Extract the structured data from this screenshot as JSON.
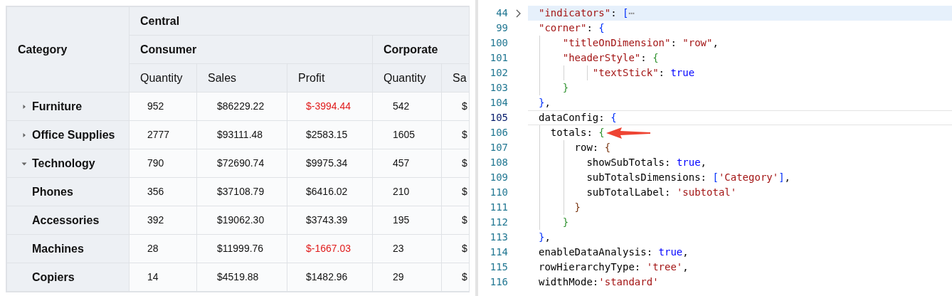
{
  "pivot_table": {
    "corner_title": "Category",
    "column_groups": [
      {
        "label": "Central",
        "children": [
          {
            "label": "Consumer",
            "measures": [
              "Quantity",
              "Sales",
              "Profit"
            ]
          },
          {
            "label": "Corporate",
            "measures": [
              "Quantity",
              "Sa"
            ]
          }
        ]
      }
    ],
    "rows": [
      {
        "label": "Furniture",
        "expanded": false,
        "cells": [
          {
            "text": "952",
            "negative": false
          },
          {
            "text": "$86229.22",
            "negative": false
          },
          {
            "text": "$-3994.44",
            "negative": true
          },
          {
            "text": "542",
            "negative": false
          },
          {
            "text": "$",
            "negative": false
          }
        ]
      },
      {
        "label": "Office Supplies",
        "expanded": false,
        "cells": [
          {
            "text": "2777",
            "negative": false
          },
          {
            "text": "$93111.48",
            "negative": false
          },
          {
            "text": "$2583.15",
            "negative": false
          },
          {
            "text": "1605",
            "negative": false
          },
          {
            "text": "$",
            "negative": false
          }
        ]
      },
      {
        "label": "Technology",
        "expanded": true,
        "cells": [
          {
            "text": "790",
            "negative": false
          },
          {
            "text": "$72690.74",
            "negative": false
          },
          {
            "text": "$9975.34",
            "negative": false
          },
          {
            "text": "457",
            "negative": false
          },
          {
            "text": "$",
            "negative": false
          }
        ],
        "children": [
          {
            "label": "Phones",
            "cells": [
              {
                "text": "356",
                "negative": false
              },
              {
                "text": "$37108.79",
                "negative": false
              },
              {
                "text": "$6416.02",
                "negative": false
              },
              {
                "text": "210",
                "negative": false
              },
              {
                "text": "$",
                "negative": false
              }
            ]
          },
          {
            "label": "Accessories",
            "cells": [
              {
                "text": "392",
                "negative": false
              },
              {
                "text": "$19062.30",
                "negative": false
              },
              {
                "text": "$3743.39",
                "negative": false
              },
              {
                "text": "195",
                "negative": false
              },
              {
                "text": "$",
                "negative": false
              }
            ]
          },
          {
            "label": "Machines",
            "cells": [
              {
                "text": "28",
                "negative": false
              },
              {
                "text": "$11999.76",
                "negative": false
              },
              {
                "text": "$-1667.03",
                "negative": true
              },
              {
                "text": "23",
                "negative": false
              },
              {
                "text": "$",
                "negative": false
              }
            ]
          },
          {
            "label": "Copiers",
            "cells": [
              {
                "text": "14",
                "negative": false
              },
              {
                "text": "$4519.88",
                "negative": false
              },
              {
                "text": "$1482.96",
                "negative": false
              },
              {
                "text": "29",
                "negative": false
              },
              {
                "text": "$",
                "negative": false
              }
            ]
          }
        ]
      }
    ]
  },
  "code_editor": {
    "lines": [
      {
        "number": "44",
        "folded": true,
        "highlighted": true,
        "current": false,
        "marked": false,
        "tokens": [
          {
            "kind": "key",
            "t": "\"indicators\""
          },
          {
            "kind": "punct",
            "t": ": "
          },
          {
            "kind": "b1",
            "t": "["
          },
          {
            "kind": "fold",
            "t": "⋯"
          }
        ]
      },
      {
        "number": "99",
        "folded": false,
        "highlighted": false,
        "current": false,
        "marked": false,
        "tokens": [
          {
            "kind": "key",
            "t": "\"corner\""
          },
          {
            "kind": "punct",
            "t": ": "
          },
          {
            "kind": "b1",
            "t": "{"
          }
        ]
      },
      {
        "number": "100",
        "folded": false,
        "highlighted": false,
        "current": false,
        "marked": false,
        "tokens": [
          {
            "kind": "key",
            "t": "    \"titleOnDimension\""
          },
          {
            "kind": "punct",
            "t": ": "
          },
          {
            "kind": "str",
            "t": "\"row\""
          },
          {
            "kind": "punct",
            "t": ","
          }
        ]
      },
      {
        "number": "101",
        "folded": false,
        "highlighted": false,
        "current": false,
        "marked": false,
        "tokens": [
          {
            "kind": "key",
            "t": "    \"headerStyle\""
          },
          {
            "kind": "punct",
            "t": ": "
          },
          {
            "kind": "b2",
            "t": "{"
          }
        ]
      },
      {
        "number": "102",
        "folded": false,
        "highlighted": false,
        "current": false,
        "marked": false,
        "tokens": [
          {
            "kind": "key",
            "t": "         \"textStick\""
          },
          {
            "kind": "punct",
            "t": ": "
          },
          {
            "kind": "bool",
            "t": "true"
          }
        ]
      },
      {
        "number": "103",
        "folded": false,
        "highlighted": false,
        "current": false,
        "marked": false,
        "tokens": [
          {
            "kind": "b2",
            "t": "    }"
          }
        ]
      },
      {
        "number": "104",
        "folded": false,
        "highlighted": false,
        "current": false,
        "marked": false,
        "tokens": [
          {
            "kind": "b1",
            "t": "}"
          },
          {
            "kind": "punct",
            "t": ","
          }
        ]
      },
      {
        "number": "105",
        "folded": false,
        "highlighted": false,
        "current": true,
        "marked": false,
        "tokens": [
          {
            "kind": "plain",
            "t": "dataConfig: "
          },
          {
            "kind": "b1",
            "t": "{"
          }
        ]
      },
      {
        "number": "106",
        "folded": false,
        "highlighted": false,
        "current": false,
        "marked": true,
        "tokens": [
          {
            "kind": "plain",
            "t": "  totals: "
          },
          {
            "kind": "b2",
            "t": "{"
          }
        ]
      },
      {
        "number": "107",
        "folded": false,
        "highlighted": false,
        "current": false,
        "marked": false,
        "tokens": [
          {
            "kind": "plain",
            "t": "      row: "
          },
          {
            "kind": "b3",
            "t": "{"
          }
        ]
      },
      {
        "number": "108",
        "folded": false,
        "highlighted": false,
        "current": false,
        "marked": false,
        "tokens": [
          {
            "kind": "plain",
            "t": "        showSubTotals: "
          },
          {
            "kind": "bool",
            "t": "true"
          },
          {
            "kind": "punct",
            "t": ","
          }
        ]
      },
      {
        "number": "109",
        "folded": false,
        "highlighted": false,
        "current": false,
        "marked": false,
        "tokens": [
          {
            "kind": "plain",
            "t": "        subTotalsDimensions: "
          },
          {
            "kind": "b1",
            "t": "["
          },
          {
            "kind": "str",
            "t": "'Category'"
          },
          {
            "kind": "b1",
            "t": "]"
          },
          {
            "kind": "punct",
            "t": ","
          }
        ]
      },
      {
        "number": "110",
        "folded": false,
        "highlighted": false,
        "current": false,
        "marked": false,
        "tokens": [
          {
            "kind": "plain",
            "t": "        subTotalLabel: "
          },
          {
            "kind": "str",
            "t": "'subtotal'"
          }
        ]
      },
      {
        "number": "111",
        "folded": false,
        "highlighted": false,
        "current": false,
        "marked": false,
        "tokens": [
          {
            "kind": "b3",
            "t": "      }"
          }
        ]
      },
      {
        "number": "112",
        "folded": false,
        "highlighted": false,
        "current": false,
        "marked": false,
        "tokens": [
          {
            "kind": "b2",
            "t": "    }"
          }
        ]
      },
      {
        "number": "113",
        "folded": false,
        "highlighted": false,
        "current": false,
        "marked": false,
        "tokens": [
          {
            "kind": "b1",
            "t": "}"
          },
          {
            "kind": "punct",
            "t": ","
          }
        ]
      },
      {
        "number": "114",
        "folded": false,
        "highlighted": false,
        "current": false,
        "marked": false,
        "tokens": [
          {
            "kind": "plain",
            "t": "enableDataAnalysis: "
          },
          {
            "kind": "bool",
            "t": "true"
          },
          {
            "kind": "punct",
            "t": ","
          }
        ]
      },
      {
        "number": "115",
        "folded": false,
        "highlighted": false,
        "current": false,
        "marked": false,
        "tokens": [
          {
            "kind": "plain",
            "t": "rowHierarchyType: "
          },
          {
            "kind": "str",
            "t": "'tree'"
          },
          {
            "kind": "punct",
            "t": ","
          }
        ]
      },
      {
        "number": "116",
        "folded": false,
        "highlighted": false,
        "current": false,
        "marked": false,
        "tokens": [
          {
            "kind": "plain",
            "t": "widthMode:"
          },
          {
            "kind": "str",
            "t": "'standard'"
          }
        ]
      }
    ]
  }
}
